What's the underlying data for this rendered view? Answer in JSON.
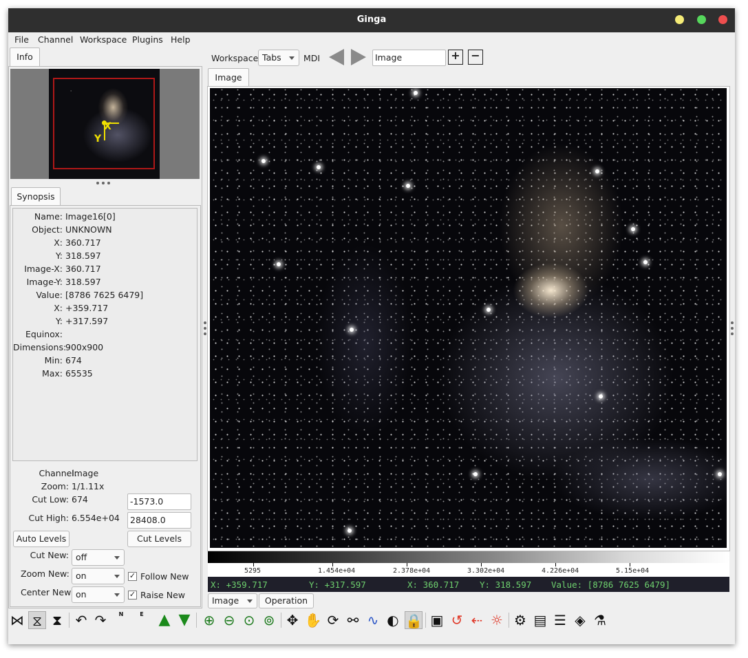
{
  "window": {
    "title": "Ginga"
  },
  "menu": [
    "File",
    "Channel",
    "Workspace",
    "Plugins",
    "Help"
  ],
  "left": {
    "top_tab": "Info",
    "synopsis_tab": "Synopsis",
    "synopsis": [
      {
        "label": "Name:",
        "value": "Image16[0]"
      },
      {
        "label": "Object:",
        "value": "UNKNOWN"
      },
      {
        "label": "X:",
        "value": "360.717"
      },
      {
        "label": "Y:",
        "value": "318.597"
      },
      {
        "label": "Image-X:",
        "value": "360.717"
      },
      {
        "label": "Image-Y:",
        "value": "318.597"
      },
      {
        "label": "Value:",
        "value": "[8786 7625 6479]"
      },
      {
        "label": "X:",
        "value": "+359.717"
      },
      {
        "label": "Y:",
        "value": "+317.597"
      },
      {
        "label": "Equinox:",
        "value": ""
      },
      {
        "label": "Dimensions:",
        "value": "900x900"
      },
      {
        "label": "Min:",
        "value": "674"
      },
      {
        "label": "Max:",
        "value": "65535"
      }
    ],
    "channel_label": "Channel:",
    "channel_value": "Image",
    "zoom_label": "Zoom:",
    "zoom_value": "1/1.11x",
    "cut_low_label": "Cut Low:",
    "cut_low_value": "674",
    "cut_low_input": "-1573.0",
    "cut_high_label": "Cut High:",
    "cut_high_value": "6.554e+04",
    "cut_high_input": "28408.0",
    "auto_levels": "Auto Levels",
    "cut_levels": "Cut Levels",
    "cut_new_label": "Cut New:",
    "cut_new_value": "off",
    "zoom_new_label": "Zoom New:",
    "zoom_new_value": "on",
    "center_new_label": "Center New:",
    "center_new_value": "on",
    "follow_new": "Follow New",
    "follow_new_checked": "✓",
    "raise_new": "Raise New",
    "raise_new_checked": "✓",
    "thumb_labels": {
      "x": "X",
      "y": "Y"
    }
  },
  "workspace": {
    "label": "Workspace",
    "mode": "Tabs",
    "mdi": "MDI",
    "channel_input": "Image",
    "image_tab": "Image"
  },
  "colorbar": {
    "ticks": [
      "5295",
      "1.454e+04",
      "2.378e+04",
      "3.302e+04",
      "4.226e+04",
      "5.15e+04"
    ]
  },
  "readout": {
    "x_plus": "X: +359.717",
    "y_plus": "Y: +317.597",
    "x": "X: 360.717",
    "y": "Y: 318.597",
    "value": "Value: [8786 7625 6479]"
  },
  "bottom_tabs": {
    "image": "Image",
    "operation": "Operation"
  },
  "toolbar_icons": {
    "compass_n": "N",
    "compass_e": "E"
  },
  "colors": {
    "titlebar": "#2f2f2f",
    "close": "#ee4e4e",
    "maximize": "#56d75c",
    "minimize": "#f5ec77",
    "readout_text": "#6ed16e"
  }
}
